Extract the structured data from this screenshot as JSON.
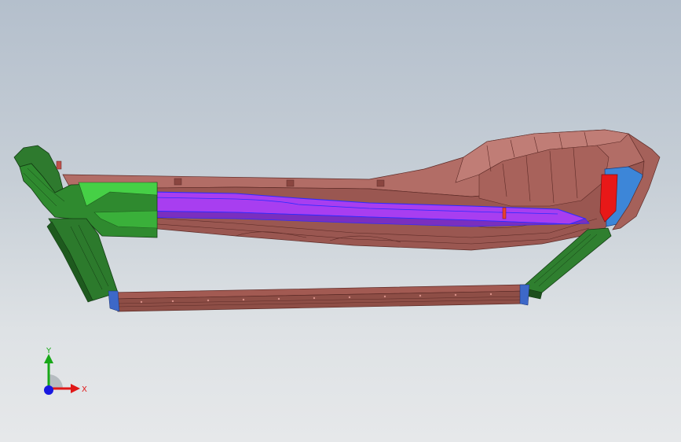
{
  "viewport": {
    "background_top": "#b4bfcc",
    "background_bottom": "#e6e8ea"
  },
  "model": {
    "colors": {
      "body": "#b4706a",
      "body_dark": "#7a3f3a",
      "rail": "#8e4e46",
      "channel": "#a43cf0",
      "channel_edge": "#2c2cff",
      "bracket": "#2f7a2f",
      "bracket_light": "#3ec83e",
      "bracket_dark": "#1c4e1c",
      "end_cap": "#e81010",
      "end_cap_blue": "#3d86d8"
    }
  },
  "triad": {
    "x_label": "X",
    "y_label": "Y",
    "x_color": "#e01818",
    "y_color": "#18a818",
    "z_color": "#1818e0",
    "icons": [
      "x-axis-arrow-icon",
      "y-axis-arrow-icon",
      "z-axis-dot-icon"
    ]
  }
}
